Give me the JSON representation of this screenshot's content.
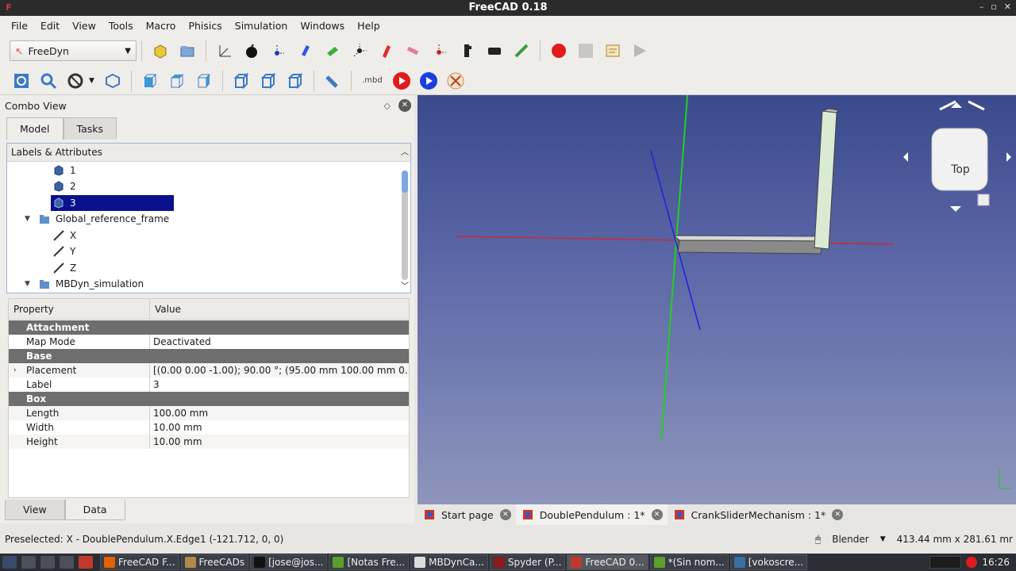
{
  "window": {
    "title": "FreeCAD 0.18",
    "controls": [
      "–",
      "▫",
      "✕"
    ]
  },
  "menu": [
    "File",
    "Edit",
    "View",
    "Tools",
    "Macro",
    "Phisics",
    "Simulation",
    "Windows",
    "Help"
  ],
  "workbench": {
    "selected": "FreeDyn"
  },
  "toolbar2_label": ".mbd",
  "combo": {
    "title": "Combo View",
    "tabs": [
      "Model",
      "Tasks"
    ],
    "tree_header": "Labels & Attributes",
    "tree": [
      {
        "label": "1",
        "icon": "box-icon"
      },
      {
        "label": "2",
        "icon": "box-icon"
      },
      {
        "label": "3",
        "icon": "box-icon",
        "selected": true
      },
      {
        "label": "Global_reference_frame",
        "icon": "folder-icon",
        "expanded": true
      },
      {
        "label": "X",
        "icon": "line-icon"
      },
      {
        "label": "Y",
        "icon": "line-icon"
      },
      {
        "label": "Z",
        "icon": "line-icon"
      },
      {
        "label": "MBDyn_simulation",
        "icon": "folder-icon",
        "expanded": true
      }
    ],
    "props_header": {
      "property": "Property",
      "value": "Value"
    },
    "props": [
      {
        "type": "group",
        "name": "Attachment"
      },
      {
        "type": "prop",
        "name": "Map Mode",
        "value": "Deactivated"
      },
      {
        "type": "group",
        "name": "Base"
      },
      {
        "type": "prop",
        "name": "Placement",
        "value": "[(0.00 0.00 -1.00); 90.00 °; (95.00 mm  100.00 mm  0...",
        "expandable": true
      },
      {
        "type": "prop",
        "name": "Label",
        "value": "3"
      },
      {
        "type": "group",
        "name": "Box"
      },
      {
        "type": "prop",
        "name": "Length",
        "value": "100.00 mm"
      },
      {
        "type": "prop",
        "name": "Width",
        "value": "10.00 mm"
      },
      {
        "type": "prop",
        "name": "Height",
        "value": "10.00 mm"
      }
    ],
    "bottom_tabs": [
      "View",
      "Data"
    ]
  },
  "navcube": {
    "face": "Top"
  },
  "doc_tabs": [
    {
      "label": "Start page",
      "active": false
    },
    {
      "label": "DoublePendulum : 1*",
      "active": true
    },
    {
      "label": "CrankSliderMechanism : 1*",
      "active": false
    }
  ],
  "status": {
    "preselected": "Preselected: X - DoublePendulum.X.Edge1 (-121.712, 0, 0)",
    "nav_style": "Blender",
    "dimensions": "413.44 mm x 281.61 mr"
  },
  "taskbar": {
    "tasks": [
      {
        "label": "FreeCAD F...",
        "color": "#e66000"
      },
      {
        "label": "FreeCADs",
        "color": "#b08a4a"
      },
      {
        "label": "[jose@jos...",
        "color": "#333333"
      },
      {
        "label": "[Notas Fre...",
        "color": "#5aa02c"
      },
      {
        "label": "MBDynCa...",
        "color": "#dddddd"
      },
      {
        "label": "Spyder (P...",
        "color": "#8b1a1a"
      },
      {
        "label": "FreeCAD 0...",
        "color": "#c0392b",
        "active": true
      },
      {
        "label": "*(Sin nom...",
        "color": "#5aa02c"
      },
      {
        "label": "[vokoscre...",
        "color": "#3a6ea5"
      }
    ],
    "clock": "16:26"
  }
}
